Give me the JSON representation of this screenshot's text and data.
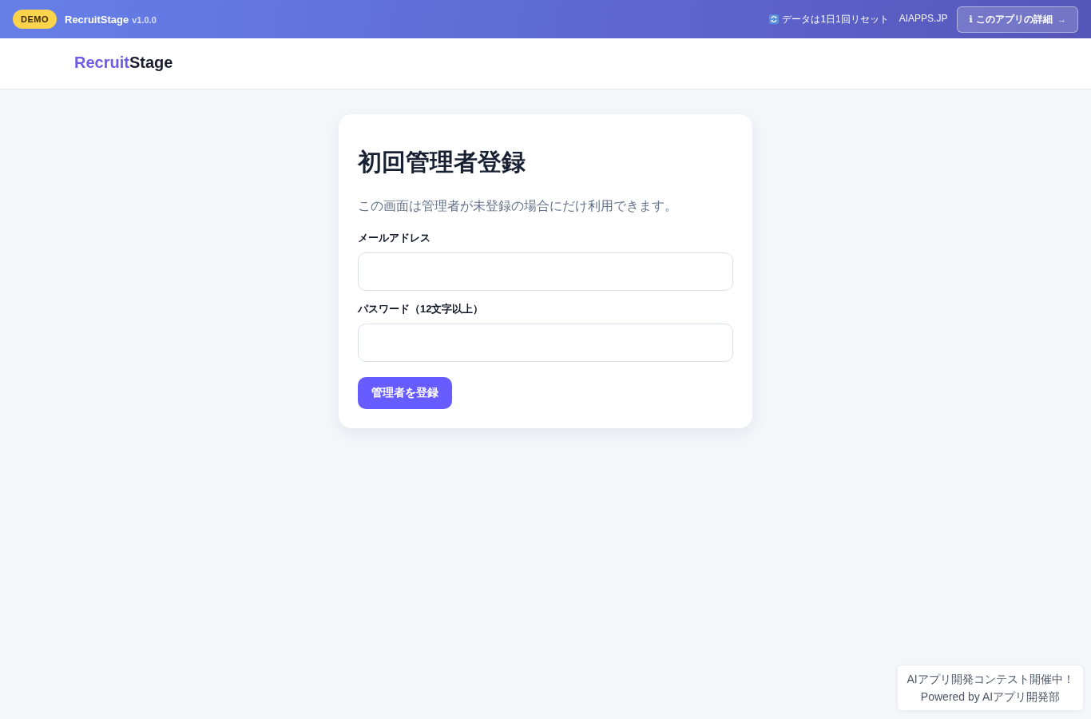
{
  "top_bar": {
    "badge": "DEMO",
    "app_name": "RecruitStage",
    "version": "v1.0.0",
    "reset_note": "データは1日1回リセット",
    "site_link": "AIAPPS.JP",
    "details_button": {
      "icon": "ℹ",
      "label": "このアプリの詳細",
      "arrow": "→"
    }
  },
  "header": {
    "logo": {
      "accent": "Recruit",
      "rest": "Stage"
    }
  },
  "form": {
    "title": "初回管理者登録",
    "description": "この画面は管理者が未登録の場合にだけ利用できます。",
    "fields": [
      {
        "label": "メールアドレス"
      },
      {
        "label": "パスワード（12文字以上）"
      }
    ],
    "submit": "管理者を登録"
  },
  "footer_note": {
    "lines": [
      "AIアプリ開発コンテスト開催中！",
      "Powered by AIアプリ開発部"
    ]
  }
}
